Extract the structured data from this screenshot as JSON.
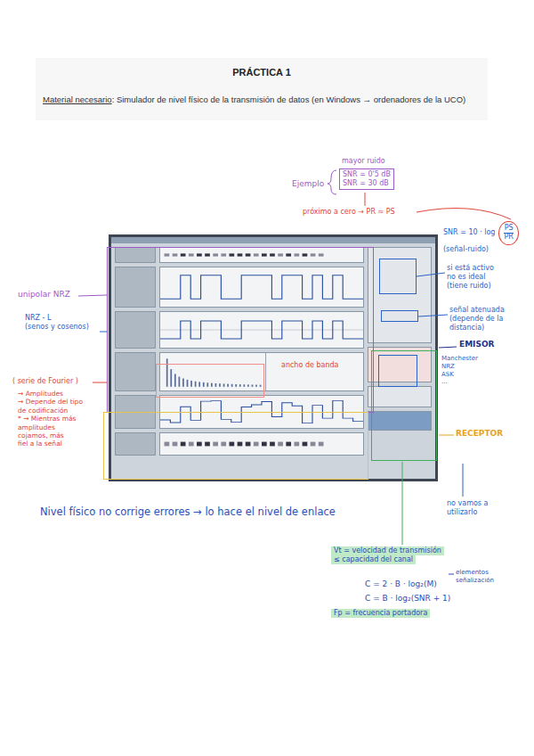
{
  "document": {
    "title": "PRÁCTICA 1",
    "material_label": "Material necesario",
    "material_text": ": Simulador de nivel físico de la transmisión de datos (en Windows → ordenadores de la UCO)"
  },
  "notes": [
    {
      "kind": "text",
      "lines": [
        "mayor ruido"
      ],
      "color": "#9b59c9",
      "boxed": false,
      "highlight": false
    },
    {
      "kind": "text",
      "lines": [
        "SNR = 0'5 dB",
        "SNR = 30 dB"
      ],
      "color": "#9b59c9",
      "boxed": true,
      "highlight": false
    },
    {
      "kind": "text",
      "lines": [
        "Ejemplo"
      ],
      "color": "#9b59c9",
      "boxed": false,
      "highlight": false
    },
    {
      "kind": "text",
      "lines": [
        "próximo a cero → PR ≈ PS"
      ],
      "color": "#e0453a",
      "boxed": false,
      "highlight": false
    },
    {
      "kind": "fraction",
      "lines": [
        "SNR = 10 · log",
        "(señal-ruido)"
      ],
      "numerator": "PS",
      "denominator": "PR",
      "color": "#2a63c7",
      "boxed": false,
      "highlight": false
    },
    {
      "kind": "text",
      "lines": [
        "si está activo",
        "no es ideal",
        "(tiene ruido)"
      ],
      "color": "#2a63c7",
      "boxed": false,
      "highlight": false
    },
    {
      "kind": "text",
      "lines": [
        "señal atenuada",
        "(depende de la",
        "distancia)"
      ],
      "color": "#2a63c7",
      "boxed": false,
      "highlight": false
    },
    {
      "kind": "heading",
      "lines": [
        "EMISOR"
      ],
      "color": "#1f2f8a",
      "boxed": false,
      "highlight": false
    },
    {
      "kind": "text",
      "lines": [
        "Manchester",
        "NRZ",
        "ASK",
        "..."
      ],
      "color": "#2a63c7",
      "boxed": false,
      "highlight": false
    },
    {
      "kind": "heading",
      "lines": [
        "RECEPTOR"
      ],
      "color": "#e8a21c",
      "boxed": false,
      "highlight": false
    },
    {
      "kind": "text",
      "lines": [
        "no vamos a",
        "utilizarlo"
      ],
      "color": "#2a63c7",
      "boxed": false,
      "highlight": false
    },
    {
      "kind": "text",
      "lines": [
        "unipolar NRZ"
      ],
      "color": "#9b59c9",
      "boxed": false,
      "highlight": false
    },
    {
      "kind": "text",
      "lines": [
        "NRZ - L",
        "(senos y cosenos)"
      ],
      "color": "#2a63c7",
      "boxed": false,
      "highlight": false
    },
    {
      "kind": "text",
      "lines": [
        "( serie de Fourier )"
      ],
      "color": "#e0453a",
      "boxed": false,
      "highlight": false
    },
    {
      "kind": "text",
      "lines": [
        "→ Amplitudes",
        "→ Depende del tipo",
        "de codificación",
        "* → Mientras más",
        "amplitudes",
        "cojamos, más",
        "fiel a la señal"
      ],
      "color": "#e0453a",
      "boxed": false,
      "highlight": false
    },
    {
      "kind": "text",
      "lines": [
        "ancho de banda"
      ],
      "color": "#e0453a",
      "boxed": false,
      "highlight": false
    },
    {
      "kind": "text",
      "lines": [
        "Nivel físico no corrige errores → lo hace el nivel de enlace"
      ],
      "color": "#2a4fb8",
      "boxed": false,
      "highlight": false
    },
    {
      "kind": "text",
      "lines": [
        "Vt = velocidad de transmisión",
        "≤ capacidad del canal"
      ],
      "color": "#2a4fb8",
      "boxed": false,
      "highlight": true
    },
    {
      "kind": "text",
      "lines": [
        "C = 2 · B · log₂(M)"
      ],
      "color": "#2a4fb8",
      "boxed": false,
      "highlight": false
    },
    {
      "kind": "text",
      "lines": [
        "elementos",
        "señalización"
      ],
      "color": "#2a4fb8",
      "boxed": false,
      "highlight": false
    },
    {
      "kind": "text",
      "lines": [
        "C = B · log₂(SNR + 1)"
      ],
      "color": "#2a4fb8",
      "boxed": false,
      "highlight": false
    },
    {
      "kind": "text",
      "lines": [
        "Fp = frecuencia portadora"
      ],
      "color": "#2a4fb8",
      "boxed": false,
      "highlight": true
    }
  ]
}
